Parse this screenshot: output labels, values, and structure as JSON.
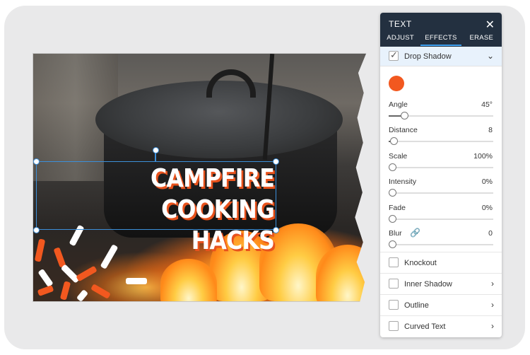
{
  "headline": {
    "line1": "CAMPFIRE COOKING",
    "line2": "HACKS"
  },
  "panel": {
    "title": "TEXT",
    "close_icon": "close-icon",
    "tabs": [
      {
        "label": "ADJUST",
        "active": false
      },
      {
        "label": "EFFECTS",
        "active": true
      },
      {
        "label": "ERASE",
        "active": false
      }
    ],
    "drop_shadow": {
      "label": "Drop Shadow",
      "checked": true,
      "color": "#f2581f"
    },
    "sliders": [
      {
        "label": "Angle",
        "value": "45°",
        "fraction": 0.15
      },
      {
        "label": "Distance",
        "value": "8",
        "fraction": 0.05
      },
      {
        "label": "Scale",
        "value": "100%",
        "fraction": 0.0
      },
      {
        "label": "Intensity",
        "value": "0%",
        "fraction": 0.0
      },
      {
        "label": "Fade",
        "value": "0%",
        "fraction": 0.0
      },
      {
        "label": "Blur",
        "value": "0",
        "fraction": 0.0,
        "icon": "link-icon"
      }
    ],
    "options": [
      {
        "label": "Knockout",
        "checked": false,
        "has_chevron": false
      },
      {
        "label": "Inner Shadow",
        "checked": false,
        "has_chevron": true
      },
      {
        "label": "Outline",
        "checked": false,
        "has_chevron": true
      },
      {
        "label": "Curved Text",
        "checked": false,
        "has_chevron": true
      }
    ]
  }
}
